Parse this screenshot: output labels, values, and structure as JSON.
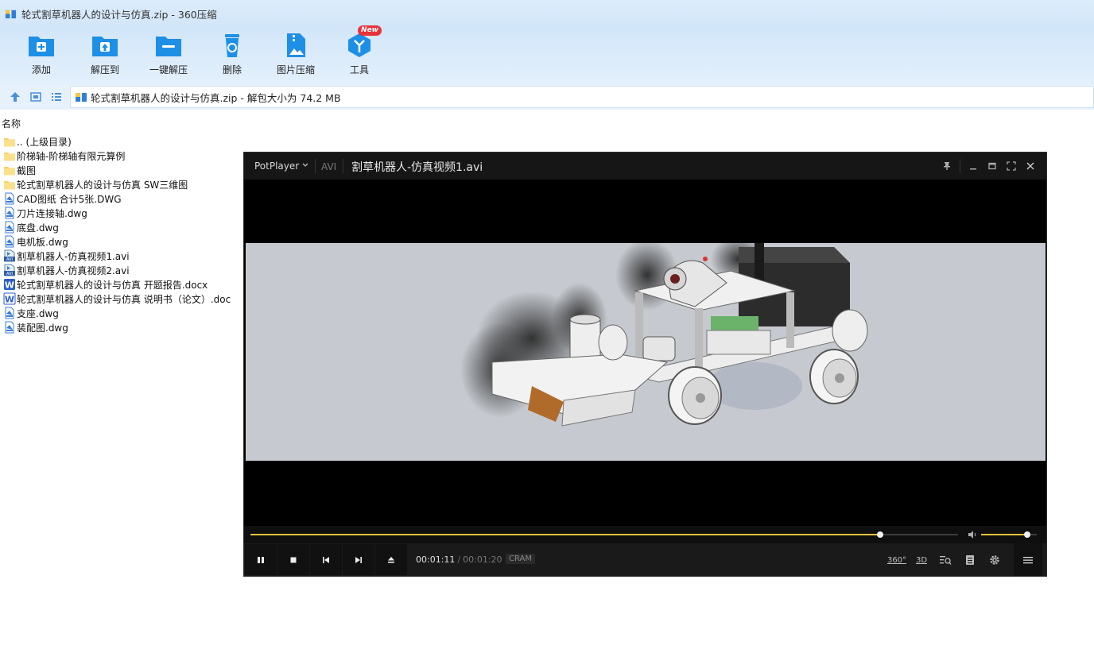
{
  "window": {
    "title": "轮式割草机器人的设计与仿真.zip - 360压缩"
  },
  "toolbar": {
    "items": [
      {
        "label": "添加",
        "icon": "add-icon"
      },
      {
        "label": "解压到",
        "icon": "extract-to-icon"
      },
      {
        "label": "一键解压",
        "icon": "one-click-extract-icon"
      },
      {
        "label": "删除",
        "icon": "delete-icon"
      },
      {
        "label": "图片压缩",
        "icon": "image-compress-icon"
      },
      {
        "label": "工具",
        "icon": "tools-icon",
        "badge": "New"
      }
    ]
  },
  "pathbar": {
    "address": "轮式割草机器人的设计与仿真.zip - 解包大小为 74.2 MB"
  },
  "filelist": {
    "column_name": "名称",
    "files": [
      {
        "name": ".. (上级目录)",
        "type": "folder"
      },
      {
        "name": "阶梯轴-阶梯轴有限元算例",
        "type": "folder"
      },
      {
        "name": "截图",
        "type": "folder"
      },
      {
        "name": "轮式割草机器人的设计与仿真 SW三维图",
        "type": "folder"
      },
      {
        "name": "CAD图纸 合计5张.DWG",
        "type": "dwg"
      },
      {
        "name": "刀片连接轴.dwg",
        "type": "dwg"
      },
      {
        "name": "底盘.dwg",
        "type": "dwg"
      },
      {
        "name": "电机板.dwg",
        "type": "dwg"
      },
      {
        "name": "割草机器人-仿真视频1.avi",
        "type": "avi"
      },
      {
        "name": "割草机器人-仿真视频2.avi",
        "type": "avi"
      },
      {
        "name": "轮式割草机器人的设计与仿真 开题报告.docx",
        "type": "docx"
      },
      {
        "name": "轮式割草机器人的设计与仿真 说明书（论文）.doc",
        "type": "doc"
      },
      {
        "name": "支座.dwg",
        "type": "dwg"
      },
      {
        "name": "装配图.dwg",
        "type": "dwg"
      }
    ]
  },
  "player": {
    "brand": "PotPlayer",
    "format": "AVI",
    "file": "割草机器人-仿真视频1.avi",
    "current_time": "00:01:11",
    "total_time": "00:01:20",
    "codec_tag": "CRAM",
    "progress_fraction": 0.89,
    "volume_fraction": 0.83,
    "labels": {
      "vr": "360°",
      "three_d": "3D"
    }
  },
  "colors": {
    "folder": "#f6d36b",
    "accent_blue": "#1e8fe6",
    "seek_fill": "#e3c23c",
    "badge": "#e8333a"
  }
}
